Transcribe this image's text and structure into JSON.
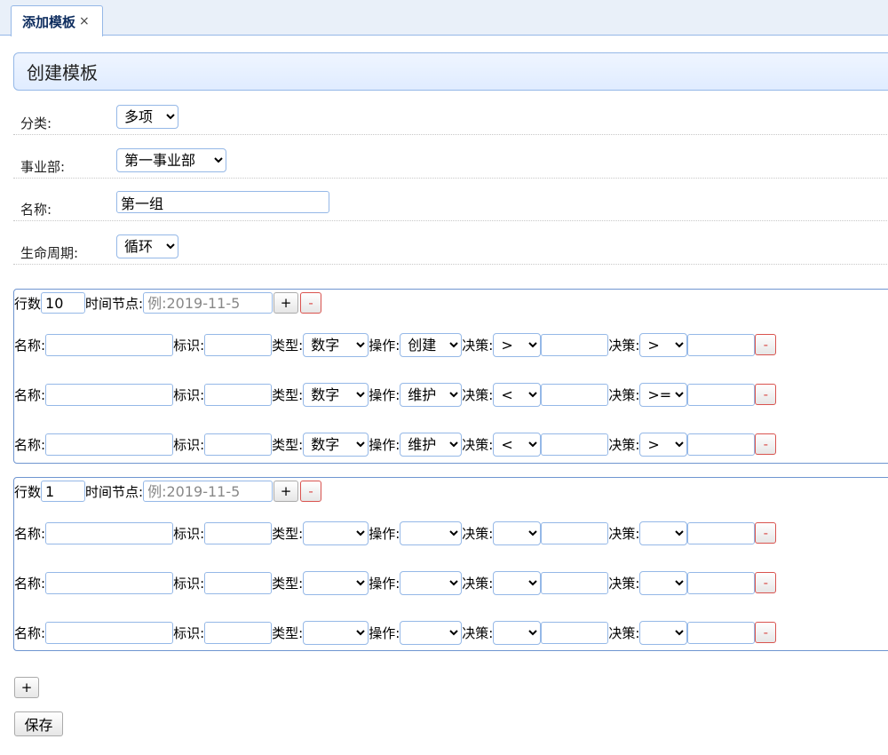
{
  "tab": {
    "title": "添加模板",
    "close": "×"
  },
  "panel": {
    "title": "创建模板"
  },
  "form": {
    "category_label": "分类:",
    "category_value": "多项",
    "division_label": "事业部:",
    "division_value": "第一事业部",
    "name_label": "名称:",
    "name_value": "第一组",
    "lifecycle_label": "生命周期:",
    "lifecycle_value": "循环"
  },
  "labels": {
    "rows": "行数",
    "time_node": "时间节点:",
    "time_placeholder": "例:2019-11-5",
    "name": "名称:",
    "tag": "标识:",
    "type": "类型:",
    "op": "操作:",
    "decision": "决策:",
    "plus": "+",
    "minus": "-"
  },
  "groups": [
    {
      "rows_count": "10",
      "items": [
        {
          "type": "数字",
          "op": "创建",
          "d1": ">",
          "d2": ">"
        },
        {
          "type": "数字",
          "op": "维护",
          "d1": "<",
          "d2": ">="
        },
        {
          "type": "数字",
          "op": "维护",
          "d1": "<",
          "d2": ">"
        }
      ]
    },
    {
      "rows_count": "1",
      "items": [
        {
          "type": "",
          "op": "",
          "d1": "",
          "d2": ""
        },
        {
          "type": "",
          "op": "",
          "d1": "",
          "d2": ""
        },
        {
          "type": "",
          "op": "",
          "d1": "",
          "d2": ""
        }
      ]
    }
  ],
  "add_group_label": "+",
  "save_label": "保存"
}
